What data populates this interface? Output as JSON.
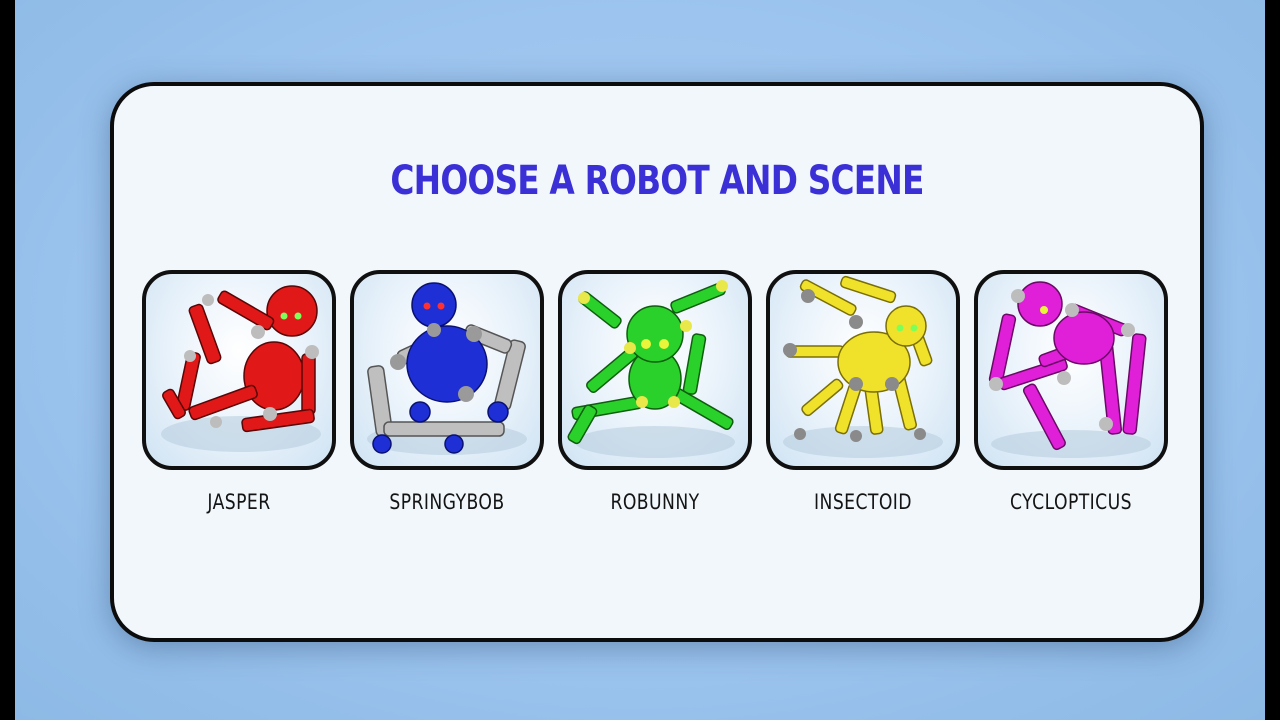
{
  "title": "CHOOSE A ROBOT AND SCENE",
  "robots": [
    {
      "name": "JASPER",
      "color": "#e01818",
      "dark": "#8a0a0a"
    },
    {
      "name": "SPRINGYBOB",
      "color": "#1f2fd6",
      "dark": "#0c1580"
    },
    {
      "name": "ROBUNNY",
      "color": "#2bd12b",
      "dark": "#127412"
    },
    {
      "name": "INSECTOID",
      "color": "#f0e22a",
      "dark": "#9a8c0a"
    },
    {
      "name": "CYCLOPTICUS",
      "color": "#e020d8",
      "dark": "#7c0a78"
    }
  ]
}
